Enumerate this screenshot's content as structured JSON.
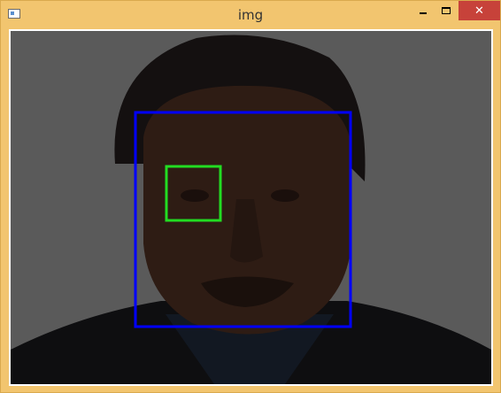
{
  "window": {
    "title": "img",
    "icon": "app-icon",
    "controls": {
      "minimize": "minimize-icon",
      "maximize": "maximize-icon",
      "close": "close-icon"
    }
  },
  "detections": {
    "face_box_color": "#0000ff",
    "eye_box_color": "#22dd22"
  }
}
